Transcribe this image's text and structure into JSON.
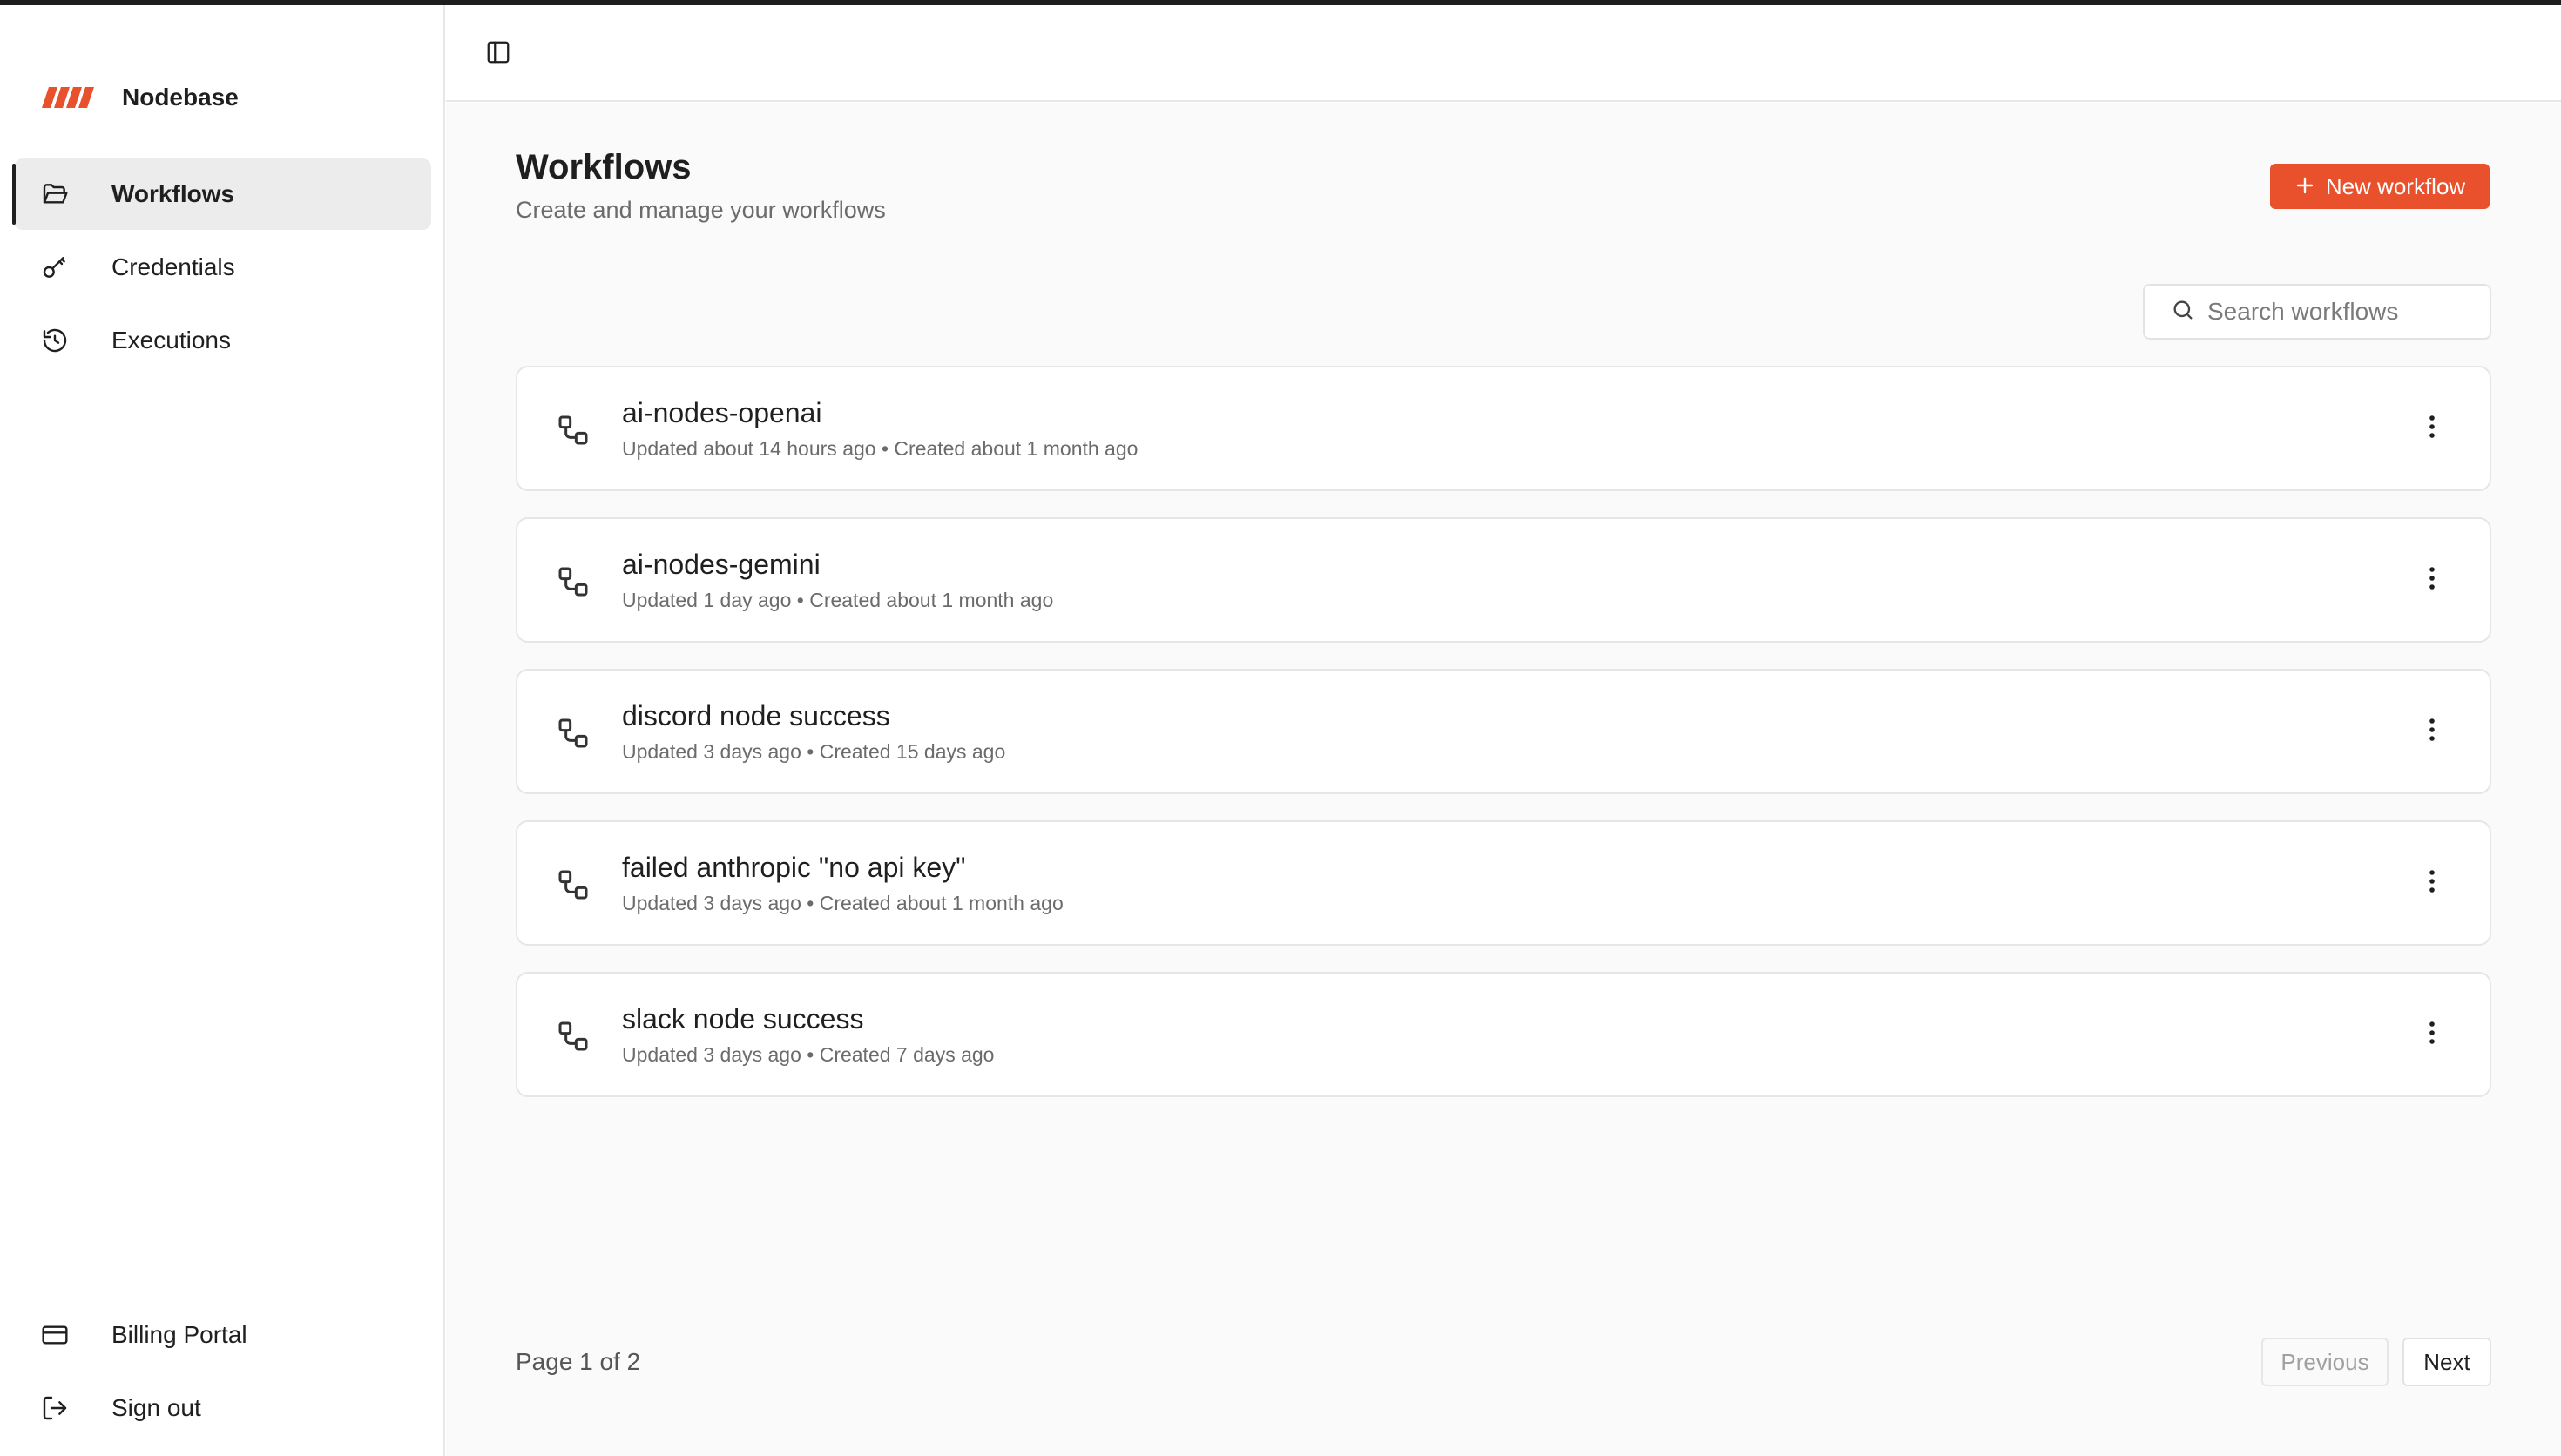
{
  "app": {
    "name": "Nodebase",
    "brand_color": "#e8512c"
  },
  "sidebar": {
    "items": [
      {
        "label": "Workflows",
        "icon": "folder-open-icon",
        "active": true
      },
      {
        "label": "Credentials",
        "icon": "key-icon",
        "active": false
      },
      {
        "label": "Executions",
        "icon": "history-icon",
        "active": false
      }
    ],
    "bottom_items": [
      {
        "label": "Billing Portal",
        "icon": "credit-card-icon"
      },
      {
        "label": "Sign out",
        "icon": "log-out-icon"
      }
    ]
  },
  "header": {
    "toggle_icon": "panel-left-icon"
  },
  "main": {
    "title": "Workflows",
    "subtitle": "Create and manage your workflows",
    "new_button_label": "New workflow",
    "search": {
      "placeholder": "Search workflows",
      "value": ""
    },
    "workflows": [
      {
        "name": "ai-nodes-openai",
        "meta": "Updated about 14 hours ago • Created about 1 month ago"
      },
      {
        "name": "ai-nodes-gemini",
        "meta": "Updated 1 day ago • Created about 1 month ago"
      },
      {
        "name": "discord node success",
        "meta": "Updated 3 days ago • Created 15 days ago"
      },
      {
        "name": "failed anthropic \"no api key\"",
        "meta": "Updated 3 days ago • Created about 1 month ago"
      },
      {
        "name": "slack node success",
        "meta": "Updated 3 days ago • Created 7 days ago"
      }
    ],
    "pagination": {
      "text": "Page 1 of 2",
      "previous_label": "Previous",
      "next_label": "Next"
    }
  }
}
